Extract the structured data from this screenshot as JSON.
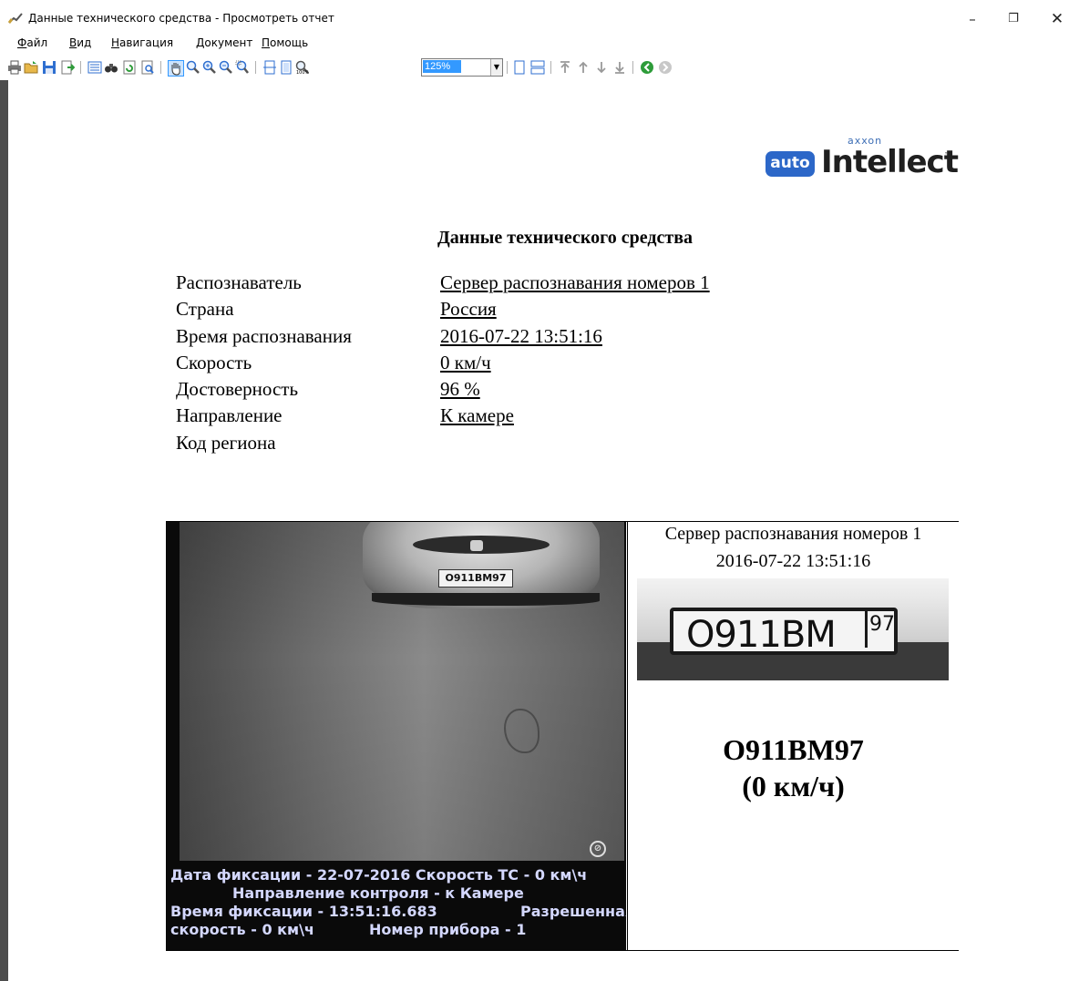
{
  "window": {
    "title": "Данные технического средства - Просмотреть отчет",
    "minimize": "–",
    "maximize": "❐",
    "close": "✕"
  },
  "menu": [
    {
      "acc": "Ф",
      "rest": "айл"
    },
    {
      "acc": "В",
      "rest": "ид"
    },
    {
      "acc": "Н",
      "rest": "авигация"
    },
    {
      "acc": "Д",
      "rest": "окумент"
    },
    {
      "acc": "П",
      "rest": "омощь"
    }
  ],
  "toolbar": {
    "zoom_value": "125%",
    "icons": [
      "print-icon",
      "open-icon",
      "save-icon",
      "export-icon",
      "toc-icon",
      "find-icon",
      "refresh-icon",
      "page-setup-icon",
      "hand-icon",
      "zoom-icon",
      "zoom-in-icon",
      "zoom-out-icon",
      "zoom-rect-icon",
      "fit-width-icon",
      "fit-page-icon",
      "actual-size-icon",
      "single-page-icon",
      "multi-page-icon",
      "first-page-icon",
      "prev-page-icon",
      "next-page-icon",
      "last-page-icon",
      "back-icon",
      "forward-icon"
    ]
  },
  "report": {
    "logo": {
      "brand_small": "axxon",
      "badge": "auto",
      "product": "Intellect",
      "tm": "™"
    },
    "title": "Данные технического средства",
    "fields": [
      {
        "label": "Распознаватель",
        "value": "Сервер распознавания номеров 1"
      },
      {
        "label": "Страна",
        "value": "Россия"
      },
      {
        "label": "Время распознавания",
        "value": "2016-07-22 13:51:16"
      },
      {
        "label": "Скорость",
        "value": "0 км/ч"
      },
      {
        "label": "Достоверность",
        "value": "96 %"
      },
      {
        "label": "Направление",
        "value": "К камере"
      },
      {
        "label": "Код региона",
        "value": ""
      }
    ],
    "capture": {
      "car_plate": "О911ВМ97",
      "overlay": {
        "line1": "Дата фиксации - 22-07-2016  Скорость ТС - 0 км\\ч",
        "line2": "Направление контроля - к Камере",
        "line3a": "Время фиксации - 13:51:16.683",
        "line3b": "Разрешенная",
        "line4a": "скорость - 0 км\\ч",
        "line4b": "Номер прибора - 1"
      },
      "server": "Сервер распознавания номеров 1",
      "time": "2016-07-22 13:51:16",
      "plate_number": "О911ВМ",
      "plate_region": "97",
      "plate_text": "О911ВМ97",
      "speed_text": "(0 км/ч)"
    }
  }
}
